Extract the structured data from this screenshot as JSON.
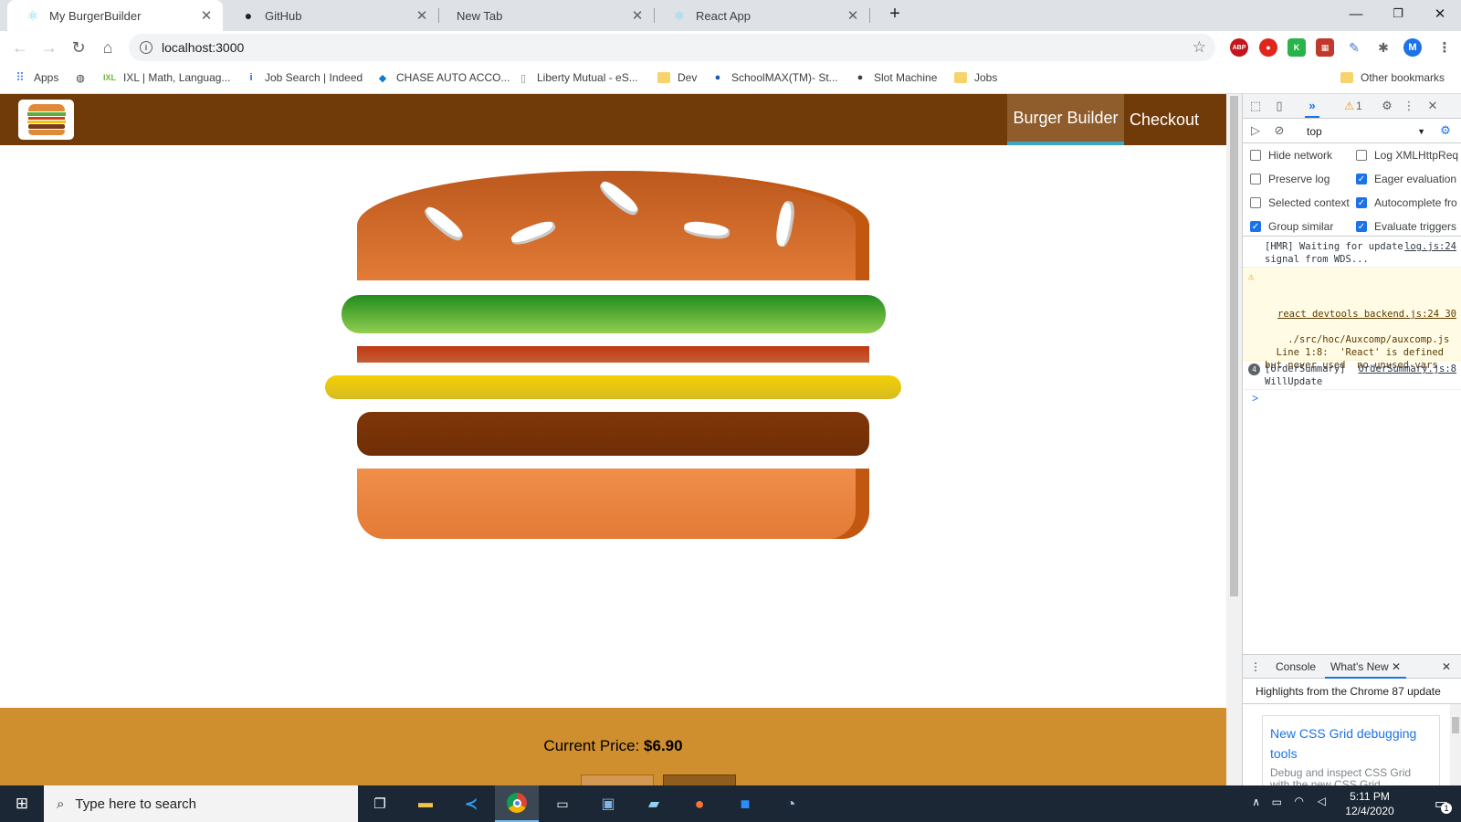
{
  "browser": {
    "tabs": [
      {
        "title": "My BurgerBuilder",
        "icon": "react-icon",
        "active": true
      },
      {
        "title": "GitHub",
        "icon": "github-icon",
        "active": false
      },
      {
        "title": "New Tab",
        "icon": "",
        "active": false
      },
      {
        "title": "React App",
        "icon": "react-icon",
        "active": false
      }
    ],
    "new_tab_label": "+",
    "url": "localhost:3000",
    "profile_initial": "M",
    "bookmarks": [
      {
        "label": "Apps",
        "icon": "apps-grid-icon"
      },
      {
        "label": "",
        "icon": "globe-icon"
      },
      {
        "label": "IXL | Math, Languag...",
        "icon": "ixl-icon"
      },
      {
        "label": "Job Search | Indeed",
        "icon": "indeed-icon"
      },
      {
        "label": "CHASE AUTO ACCO...",
        "icon": "chase-icon"
      },
      {
        "label": "Liberty Mutual - eS...",
        "icon": "page-icon"
      },
      {
        "label": "Dev",
        "icon": "folder-icon"
      },
      {
        "label": "SchoolMAX(TM)- St...",
        "icon": "schoolmax-icon"
      },
      {
        "label": "Slot Machine",
        "icon": "github-icon"
      },
      {
        "label": "Jobs",
        "icon": "folder-icon"
      }
    ],
    "other_bookmarks": "Other bookmarks",
    "extensions": {
      "abp": "ABP"
    }
  },
  "app": {
    "nav": [
      {
        "label": "Burger Builder",
        "active": true
      },
      {
        "label": "Checkout",
        "active": false
      }
    ],
    "price_label": "Current Price:",
    "price_value": "$6.90",
    "ingredients": [
      "salad",
      "bacon",
      "cheese",
      "meat"
    ],
    "colors": {
      "toolbar": "#703b09",
      "controls": "#cf8f2e",
      "active_nav": "#8f5c2c",
      "active_border": "#40a4c8"
    }
  },
  "devtools": {
    "context": "top",
    "warning_count": "1",
    "options": [
      {
        "label": "Hide network",
        "checked": false
      },
      {
        "label": "Log XMLHttpReq",
        "checked": false
      },
      {
        "label": "Preserve log",
        "checked": false
      },
      {
        "label": "Eager evaluation",
        "checked": true
      },
      {
        "label": "Selected context",
        "checked": false
      },
      {
        "label": "Autocomplete fro",
        "checked": true
      },
      {
        "label": "Group similar",
        "checked": true
      },
      {
        "label": "Evaluate triggers",
        "checked": true
      }
    ],
    "messages": [
      {
        "type": "log",
        "text": "[HMR] Waiting for update signal from WDS...",
        "source": "log.js:24"
      },
      {
        "type": "warn",
        "text": "./src/hoc/Auxcomp/auxcomp.js\n  Line 1:8:  'React' is defined but never used  no-unused-vars",
        "source": "react devtools backend.js:24 30"
      },
      {
        "type": "info",
        "count": "4",
        "text": "[OrderSummary] WillUpdate",
        "source": "OrderSummary.js:8"
      }
    ],
    "prompt": ">",
    "drawer_tabs": [
      "Console",
      "What's New"
    ],
    "whats_new_heading": "Highlights from the Chrome 87 update",
    "card_title": "New CSS Grid debugging tools",
    "card_text": "Debug and inspect CSS Grid with the new CSS Grid debugging tools."
  },
  "taskbar": {
    "search_placeholder": "Type here to search",
    "time": "5:11 PM",
    "date": "12/4/2020",
    "notification_count": "1"
  }
}
